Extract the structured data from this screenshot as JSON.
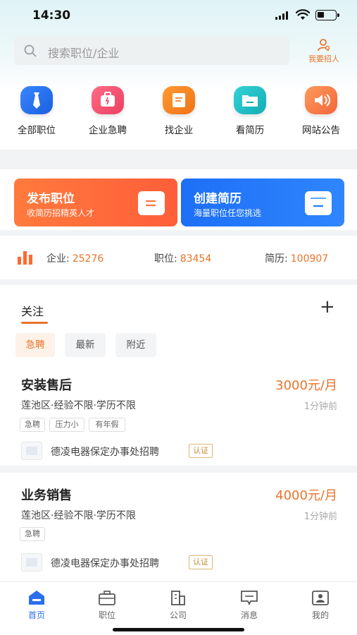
{
  "status_bar": {
    "time": "14:30"
  },
  "search": {
    "placeholder": "搜索职位/企业"
  },
  "recruit": {
    "label": "我要招人"
  },
  "categories": [
    {
      "label": "全部职位",
      "icon": "tie-icon",
      "color": "#1f6ff0"
    },
    {
      "label": "企业急聘",
      "icon": "briefcase-icon",
      "color": "#f04a6a"
    },
    {
      "label": "找企业",
      "icon": "building-icon",
      "color": "#f5841f"
    },
    {
      "label": "看简历",
      "icon": "folder-icon",
      "color": "#1fc3c8"
    },
    {
      "label": "网站公告",
      "icon": "speaker-icon",
      "color": "#f57a3c"
    }
  ],
  "banners": [
    {
      "title": "发布职位",
      "subtitle": "收简历招精英人才",
      "color_from": "#ff7a3c",
      "color_to": "#ff5e3a"
    },
    {
      "title": "创建简历",
      "subtitle": "海量职位任您挑选",
      "color_from": "#1d6ff5",
      "color_to": "#2f86ff"
    }
  ],
  "stats": {
    "company_label": "企业:",
    "company_value": "25276",
    "job_label": "职位:",
    "job_value": "83454",
    "resume_label": "简历:",
    "resume_value": "100907"
  },
  "follow": {
    "title": "关注",
    "plus": "+",
    "filters": [
      "急聘",
      "最新",
      "附近"
    ]
  },
  "jobs": [
    {
      "title": "安装售后",
      "salary": "3000元/月",
      "meta": "莲池区·经验不限·学历不限",
      "time": "1分钟前",
      "tags": [
        "急聘",
        "压力小",
        "有年假"
      ],
      "company": "德凌电器保定办事处招聘",
      "cert": "认证"
    },
    {
      "title": "业务销售",
      "salary": "4000元/月",
      "meta": "莲池区·经验不限·学历不限",
      "time": "1分钟前",
      "tags": [
        "急聘"
      ],
      "company": "德凌电器保定办事处招聘",
      "cert": "认证"
    }
  ],
  "tabbar": [
    {
      "label": "首页",
      "icon": "home-icon",
      "active": true
    },
    {
      "label": "职位",
      "icon": "briefcase-icon"
    },
    {
      "label": "公司",
      "icon": "building-icon"
    },
    {
      "label": "消息",
      "icon": "message-icon"
    },
    {
      "label": "我的",
      "icon": "profile-icon"
    }
  ],
  "colors": {
    "accent": "#e8742b",
    "primary": "#2a6ff0"
  }
}
